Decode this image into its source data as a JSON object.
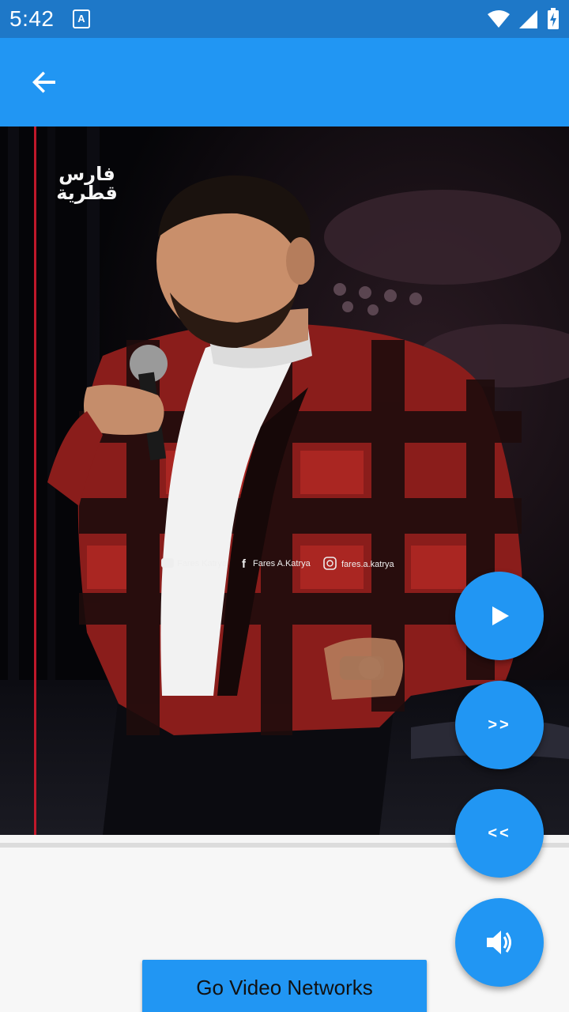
{
  "status_bar": {
    "time": "5:42",
    "notification_icon": "accessibility-app-icon",
    "icons": [
      "wifi-icon",
      "cellular-signal-icon",
      "battery-charging-icon"
    ]
  },
  "app_bar": {
    "back_icon": "arrow-back-icon",
    "color": "#2196f3"
  },
  "video": {
    "logo_text_line1": "فارس",
    "logo_text_line2": "قطرية",
    "watermark": {
      "youtube": "Fares Katrya",
      "facebook": "Fares A.Katrya",
      "instagram": "fares.a.katrya"
    }
  },
  "controls": {
    "play_icon": "play-icon",
    "forward_label": ">>",
    "rewind_label": "<<",
    "volume_icon": "volume-icon"
  },
  "go_button": {
    "label": "Go Video Networks"
  },
  "colors": {
    "accent": "#2196f3",
    "status_bar": "#1e78c8"
  }
}
